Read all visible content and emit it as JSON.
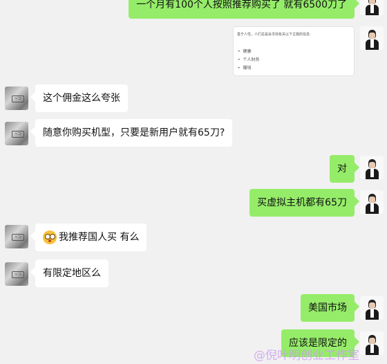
{
  "messages": [
    {
      "side": "right",
      "text": "一个月有100个人按照推荐购买了  就有6500刀了"
    },
    {
      "side": "right",
      "type": "card",
      "caption": "基于人性，人们总是会寻找有关以下主题的信息:",
      "items": [
        "健康",
        "个人财务",
        "赚钱"
      ]
    },
    {
      "side": "left",
      "text": "这个佣金这么夸张"
    },
    {
      "side": "left",
      "text": "随意你购买机型，只要是新用户就有65刀?"
    },
    {
      "side": "right",
      "text": "对"
    },
    {
      "side": "right",
      "text": "买虚拟主机都有65刀"
    },
    {
      "side": "left",
      "emoji": "flushed-face-icon",
      "text": "我推荐国人买 有么"
    },
    {
      "side": "left",
      "text": "有限定地区么"
    },
    {
      "side": "right",
      "text": "美国市场"
    },
    {
      "side": "right",
      "text": "应该是限定的"
    }
  ],
  "avatars": {
    "left": "gray-avatar",
    "right": "man-suit-avatar"
  },
  "watermark": "@倪叶明创业工作室",
  "colors": {
    "background": "#f1f1f1",
    "incoming": "#ffffff",
    "outgoing": "#95ec69"
  }
}
